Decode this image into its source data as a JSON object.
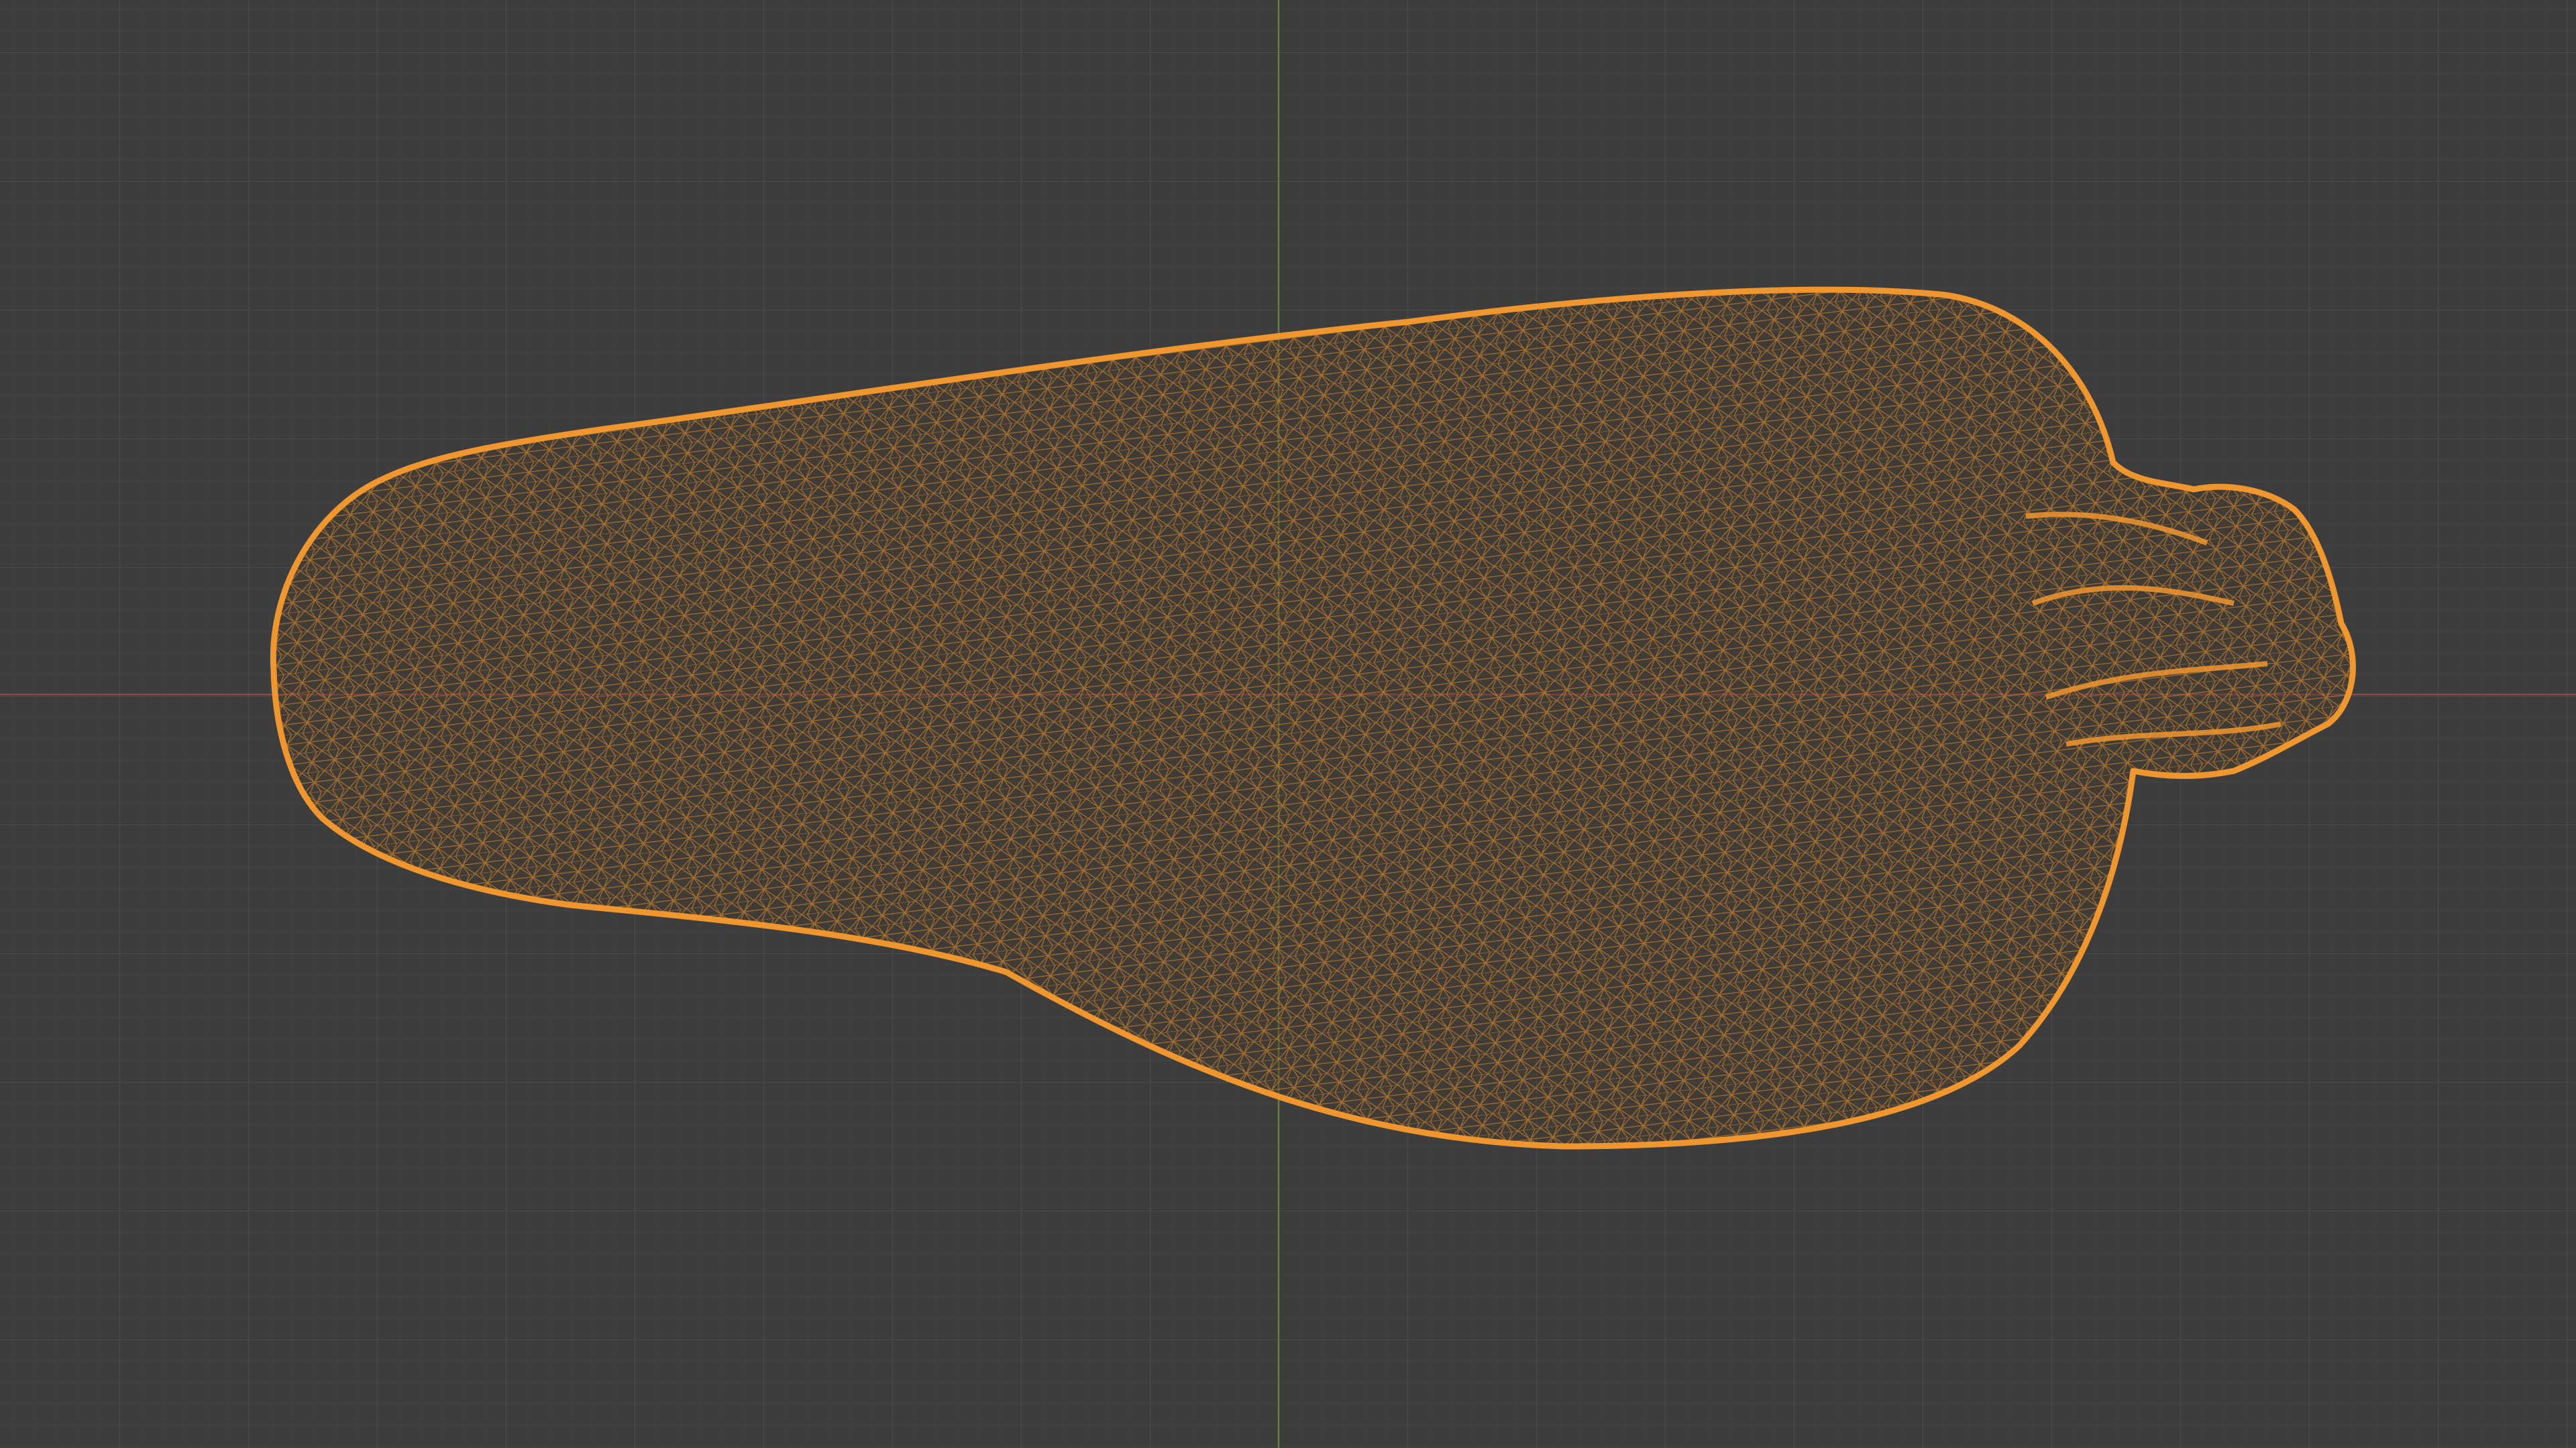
{
  "viewport": {
    "mode": "wireframe",
    "background_color": "#3d3d3d",
    "grid": {
      "visible": true,
      "minor_color": "#454545",
      "major_color": "#4c4c4c"
    },
    "axes": {
      "x_axis_color": "#8a4848",
      "y_axis_color": "#6b7a3a"
    }
  },
  "object": {
    "name_icon": "mesh-icon",
    "shape": "squash / gourd",
    "wire_color": "#f0962e",
    "selected": true
  }
}
